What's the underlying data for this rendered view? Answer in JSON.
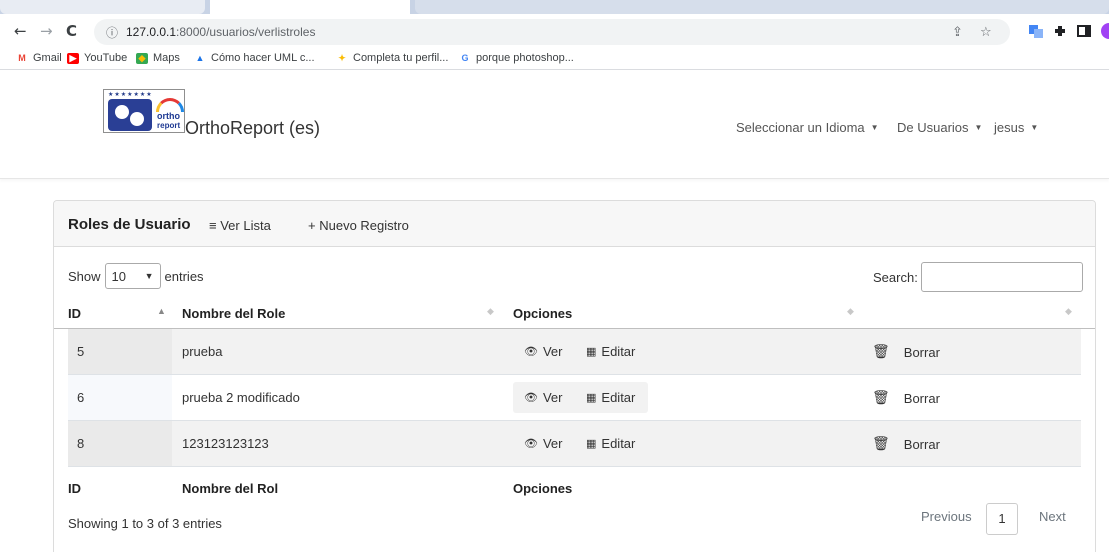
{
  "browser": {
    "url_host": "127.0.0.1",
    "url_path": ":8000/usuarios/verlistroles",
    "bookmarks": [
      {
        "label": "Gmail",
        "icon": "gmail-icon"
      },
      {
        "label": "YouTube",
        "icon": "youtube-icon"
      },
      {
        "label": "Maps",
        "icon": "maps-icon"
      },
      {
        "label": "Cómo hacer UML c...",
        "icon": "bookmark-icon"
      },
      {
        "label": "Completa tu perfil...",
        "icon": "bookmark-icon"
      },
      {
        "label": "porque photoshop...",
        "icon": "google-icon"
      }
    ]
  },
  "header": {
    "logo_line1": "ortho",
    "logo_line2": "report",
    "brand": "OrthoReport (es)",
    "nav": [
      {
        "label": "Seleccionar un Idioma"
      },
      {
        "label": "De Usuarios"
      },
      {
        "label": "jesus"
      }
    ]
  },
  "card": {
    "title": "Roles de Usuario",
    "links": [
      {
        "icon": "≡",
        "label": "Ver Lista"
      },
      {
        "icon": "+",
        "label": "Nuevo Registro"
      }
    ]
  },
  "table_controls": {
    "show_label": "Show",
    "length_value": "10",
    "entries_label": "entries",
    "search_label": "Search:",
    "search_value": ""
  },
  "table": {
    "headers": [
      "ID",
      "Nombre del Role",
      "Opciones"
    ],
    "footer": [
      "ID",
      "Nombre del Rol",
      "Opciones"
    ],
    "actions": {
      "ver": "Ver",
      "editar": "Editar",
      "borrar": "Borrar"
    },
    "rows": [
      {
        "id": "5",
        "nombre": "prueba"
      },
      {
        "id": "6",
        "nombre": "prueba 2 modificado"
      },
      {
        "id": "8",
        "nombre": "123123123123"
      }
    ]
  },
  "pagination": {
    "info": "Showing 1 to 3 of 3 entries",
    "previous": "Previous",
    "current": "1",
    "next": "Next"
  },
  "colors": {
    "chrome_tab_bg": "#c8d3e5",
    "card_header_bg": "#f7f7f7",
    "odd_row_bg": "#f2f2f2",
    "profile": "#a142f4"
  }
}
